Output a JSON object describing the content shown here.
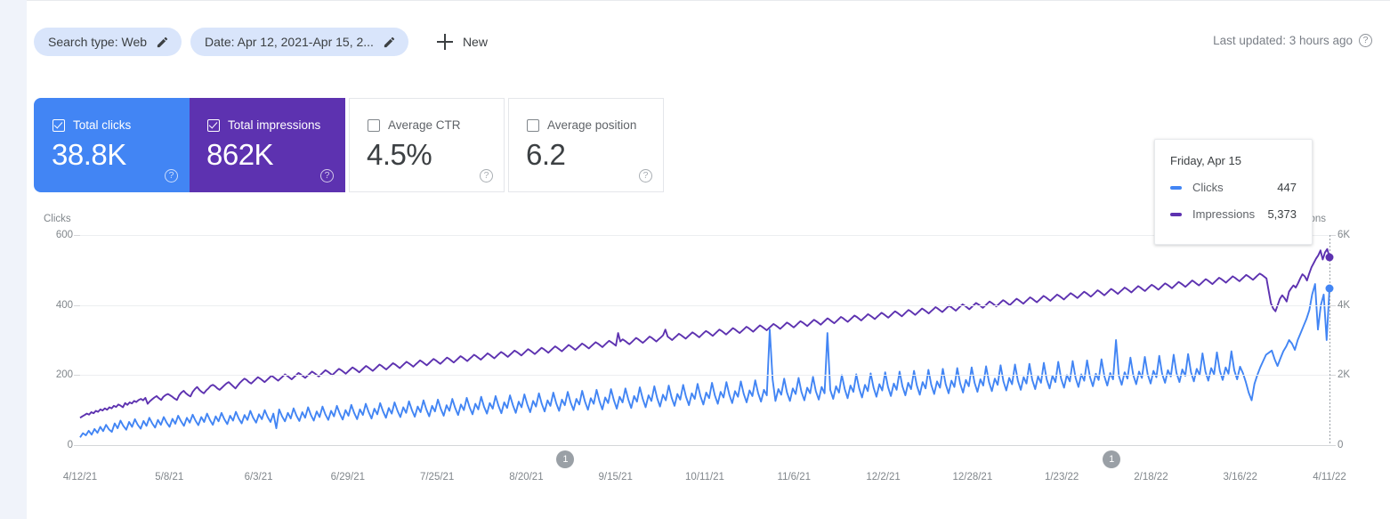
{
  "toolbar": {
    "chips": [
      {
        "label": "Search type: Web",
        "icon": "pencil-icon"
      },
      {
        "label": "Date: Apr 12, 2021-Apr 15, 2...",
        "icon": "pencil-icon"
      }
    ],
    "new_label": "New",
    "new_icon": "plus-icon",
    "last_updated": "Last updated: 3 hours ago",
    "help_icon": "help-circle-icon"
  },
  "metric_cards": [
    {
      "label": "Total clicks",
      "value": "38.8K",
      "checked": true,
      "color": "#4285f4",
      "help_icon": "help-circle-icon"
    },
    {
      "label": "Total impressions",
      "value": "862K",
      "checked": true,
      "color": "#5d32b0",
      "help_icon": "help-circle-icon"
    },
    {
      "label": "Average CTR",
      "value": "4.5%",
      "checked": false,
      "color": "#ffffff",
      "help_icon": "help-circle-icon"
    },
    {
      "label": "Average position",
      "value": "6.2",
      "checked": false,
      "color": "#ffffff",
      "help_icon": "help-circle-icon"
    }
  ],
  "tooltip": {
    "title": "Friday, Apr 15",
    "rows": [
      {
        "name": "Clicks",
        "value": "447",
        "color": "#4285f4"
      },
      {
        "name": "Impressions",
        "value": "5,373",
        "color": "#5d32b0"
      }
    ]
  },
  "annotations": [
    {
      "label": "1",
      "x_frac": 0.3885
    },
    {
      "label": "1",
      "x_frac": 0.8256
    }
  ],
  "chart_data": {
    "type": "line",
    "title": "",
    "xlabel": "",
    "ylabel": "Clicks",
    "y2label": "Impressions",
    "grid": true,
    "legend": "tooltip",
    "ylim": [
      0,
      600
    ],
    "y2lim": [
      0,
      6000
    ],
    "yticks": [
      "0",
      "200",
      "400",
      "600"
    ],
    "y2ticks": [
      "0",
      "2K",
      "4K",
      "6K"
    ],
    "xticks": [
      "4/12/21",
      "5/8/21",
      "6/3/21",
      "6/29/21",
      "7/25/21",
      "8/20/21",
      "9/15/21",
      "10/11/21",
      "11/6/21",
      "12/2/21",
      "12/28/21",
      "1/23/22",
      "2/18/22",
      "3/16/22",
      "4/11/22"
    ],
    "x_range": [
      "4/12/21",
      "4/15/22"
    ],
    "series": [
      {
        "name": "Clicks",
        "color": "#4285f4",
        "axis": "left",
        "end_value": 447,
        "values": [
          22,
          34,
          28,
          41,
          30,
          46,
          35,
          52,
          40,
          58,
          45,
          38,
          62,
          48,
          70,
          55,
          44,
          66,
          52,
          74,
          58,
          47,
          69,
          55,
          78,
          62,
          50,
          72,
          58,
          80,
          64,
          52,
          75,
          61,
          84,
          68,
          55,
          78,
          64,
          87,
          70,
          57,
          80,
          66,
          90,
          72,
          58,
          82,
          68,
          92,
          74,
          60,
          84,
          70,
          95,
          76,
          62,
          86,
          72,
          98,
          78,
          64,
          88,
          74,
          100,
          80,
          66,
          90,
          48,
          102,
          82,
          68,
          92,
          76,
          105,
          84,
          69,
          94,
          78,
          108,
          86,
          70,
          96,
          80,
          110,
          88,
          72,
          98,
          82,
          112,
          90,
          73,
          100,
          84,
          115,
          92,
          74,
          102,
          86,
          118,
          95,
          76,
          104,
          88,
          120,
          96,
          78,
          106,
          90,
          122,
          98,
          80,
          108,
          92,
          125,
          100,
          81,
          110,
          94,
          128,
          102,
          82,
          112,
          96,
          130,
          104,
          84,
          114,
          98,
          132,
          106,
          86,
          116,
          100,
          135,
          108,
          88,
          118,
          102,
          138,
          110,
          90,
          120,
          104,
          140,
          112,
          91,
          122,
          106,
          142,
          114,
          92,
          124,
          108,
          145,
          116,
          94,
          126,
          110,
          148,
          118,
          96,
          128,
          112,
          150,
          120,
          98,
          130,
          114,
          152,
          122,
          100,
          132,
          116,
          155,
          124,
          101,
          134,
          118,
          158,
          126,
          102,
          136,
          120,
          160,
          128,
          104,
          138,
          122,
          162,
          130,
          106,
          140,
          124,
          165,
          132,
          108,
          142,
          126,
          168,
          134,
          110,
          144,
          128,
          170,
          136,
          112,
          146,
          130,
          172,
          138,
          114,
          148,
          132,
          175,
          140,
          116,
          150,
          134,
          178,
          142,
          118,
          152,
          136,
          180,
          144,
          120,
          154,
          138,
          182,
          146,
          122,
          156,
          140,
          185,
          148,
          124,
          158,
          142,
          330,
          188,
          126,
          160,
          144,
          190,
          150,
          126,
          162,
          146,
          192,
          152,
          128,
          164,
          148,
          195,
          154,
          130,
          166,
          148,
          320,
          158,
          132,
          168,
          150,
          200,
          160,
          134,
          170,
          152,
          202,
          162,
          136,
          172,
          154,
          205,
          164,
          138,
          174,
          156,
          208,
          166,
          140,
          176,
          158,
          210,
          168,
          142,
          178,
          160,
          212,
          170,
          144,
          180,
          162,
          215,
          172,
          146,
          182,
          164,
          218,
          174,
          148,
          184,
          166,
          220,
          176,
          150,
          186,
          168,
          222,
          178,
          152,
          188,
          170,
          225,
          180,
          154,
          190,
          172,
          228,
          182,
          156,
          192,
          174,
          230,
          184,
          158,
          194,
          176,
          232,
          186,
          160,
          196,
          178,
          235,
          188,
          162,
          198,
          180,
          238,
          190,
          164,
          200,
          182,
          240,
          192,
          166,
          202,
          184,
          242,
          194,
          168,
          204,
          186,
          245,
          196,
          170,
          206,
          188,
          300,
          198,
          172,
          208,
          190,
          250,
          200,
          174,
          210,
          192,
          252,
          202,
          176,
          212,
          194,
          255,
          204,
          178,
          214,
          196,
          258,
          206,
          180,
          216,
          198,
          260,
          208,
          182,
          218,
          200,
          262,
          210,
          184,
          220,
          202,
          265,
          212,
          186,
          222,
          204,
          268,
          214,
          188,
          224,
          206,
          180,
          150,
          128,
          175,
          200,
          222,
          240,
          258,
          264,
          270,
          245,
          226,
          248,
          268,
          282,
          300,
          290,
          272,
          300,
          320,
          340,
          360,
          385,
          430,
          460,
          330,
          400,
          430,
          300,
          447
        ]
      },
      {
        "name": "Impressions",
        "color": "#5d32b0",
        "axis": "right",
        "end_value": 5373,
        "values": [
          780,
          820,
          860,
          900,
          870,
          940,
          910,
          980,
          950,
          1020,
          990,
          1050,
          1010,
          1080,
          1050,
          1120,
          1090,
          1160,
          1130,
          1080,
          1200,
          1150,
          1220,
          1190,
          1260,
          1230,
          1290,
          1320,
          1280,
          1350,
          1180,
          1250,
          1310,
          1360,
          1400,
          1340,
          1290,
          1380,
          1430,
          1460,
          1420,
          1380,
          1330,
          1290,
          1420,
          1500,
          1550,
          1480,
          1430,
          1390,
          1520,
          1600,
          1660,
          1580,
          1520,
          1480,
          1560,
          1620,
          1690,
          1720,
          1680,
          1620,
          1580,
          1640,
          1700,
          1760,
          1800,
          1740,
          1680,
          1620,
          1700,
          1780,
          1840,
          1900,
          1860,
          1800,
          1760,
          1820,
          1880,
          1940,
          1900,
          1850,
          1800,
          1860,
          1920,
          1980,
          1940,
          1890,
          1840,
          1900,
          1960,
          2020,
          1980,
          1930,
          1880,
          1940,
          2000,
          2060,
          2020,
          1970,
          1920,
          1980,
          2040,
          2100,
          2060,
          2010,
          1960,
          2020,
          2080,
          2140,
          2100,
          2050,
          2000,
          2060,
          2120,
          2180,
          2140,
          2090,
          2040,
          2100,
          2160,
          2220,
          2180,
          2130,
          2080,
          2140,
          2200,
          2260,
          2220,
          2170,
          2120,
          2180,
          2240,
          2300,
          2260,
          2210,
          2160,
          2220,
          2280,
          2340,
          2300,
          2250,
          2200,
          2260,
          2320,
          2380,
          2340,
          2290,
          2240,
          2300,
          2360,
          2420,
          2380,
          2330,
          2280,
          2340,
          2400,
          2460,
          2420,
          2370,
          2320,
          2380,
          2440,
          2500,
          2460,
          2410,
          2360,
          2420,
          2480,
          2540,
          2500,
          2450,
          2400,
          2460,
          2520,
          2580,
          2540,
          2490,
          2440,
          2500,
          2560,
          2620,
          2580,
          2530,
          2480,
          2540,
          2600,
          2660,
          2620,
          2570,
          2520,
          2580,
          2640,
          2700,
          2660,
          2610,
          2560,
          2620,
          2680,
          2740,
          2700,
          2650,
          2600,
          2660,
          2720,
          2780,
          2740,
          2690,
          2640,
          2700,
          2760,
          2820,
          2780,
          2730,
          2680,
          2740,
          2800,
          2860,
          2820,
          2770,
          2720,
          2780,
          2840,
          2900,
          2860,
          2810,
          2760,
          2820,
          2880,
          2940,
          2900,
          2850,
          2800,
          2860,
          2920,
          2980,
          2940,
          2890,
          2840,
          3200,
          2960,
          3020,
          2980,
          2930,
          2880,
          2940,
          3000,
          3060,
          3020,
          2970,
          2920,
          2980,
          3040,
          3100,
          3060,
          3010,
          2960,
          3020,
          3080,
          3140,
          3300,
          3100,
          3050,
          3000,
          3060,
          3120,
          3180,
          3140,
          3090,
          3040,
          3100,
          3160,
          3220,
          3180,
          3130,
          3080,
          3140,
          3200,
          3260,
          3220,
          3170,
          3120,
          3180,
          3240,
          3300,
          3260,
          3210,
          3160,
          3220,
          3280,
          3340,
          3300,
          3250,
          3200,
          3260,
          3320,
          3380,
          3340,
          3290,
          3240,
          3300,
          3360,
          3420,
          3380,
          3330,
          3280,
          3340,
          3400,
          3460,
          3420,
          3370,
          3320,
          3380,
          3440,
          3500,
          3460,
          3410,
          3360,
          3420,
          3480,
          3540,
          3500,
          3450,
          3400,
          3460,
          3520,
          3580,
          3540,
          3490,
          3440,
          3500,
          3560,
          3620,
          3580,
          3530,
          3480,
          3540,
          3600,
          3660,
          3620,
          3570,
          3520,
          3580,
          3640,
          3700,
          3660,
          3610,
          3560,
          3620,
          3680,
          3740,
          3700,
          3650,
          3600,
          3660,
          3720,
          3780,
          3740,
          3690,
          3640,
          3700,
          3760,
          3820,
          3780,
          3730,
          3680,
          3740,
          3800,
          3860,
          3820,
          3770,
          3720,
          3780,
          3840,
          3900,
          3860,
          3810,
          3760,
          3820,
          3880,
          3940,
          3900,
          3850,
          3800,
          3860,
          3920,
          3980,
          3940,
          3890,
          3840,
          3900,
          3960,
          4020,
          3980,
          3930,
          3880,
          3940,
          4000,
          4060,
          4020,
          3970,
          3920,
          3980,
          4040,
          4100,
          4060,
          4010,
          3960,
          4020,
          4080,
          4140,
          4100,
          4050,
          4000,
          4060,
          4120,
          4180,
          4140,
          4090,
          4040,
          4100,
          4160,
          4220,
          4180,
          4130,
          4080,
          4140,
          4200,
          4260,
          4220,
          4170,
          4120,
          4180,
          4240,
          4300,
          4260,
          4210,
          4160,
          4220,
          4280,
          4340,
          4300,
          4250,
          4200,
          4260,
          4320,
          4380,
          4340,
          4290,
          4240,
          4300,
          4360,
          4420,
          4380,
          4330,
          4280,
          4340,
          4400,
          4460,
          4420,
          4370,
          4320,
          4380,
          4440,
          4500,
          4460,
          4410,
          4360,
          4420,
          4480,
          4540,
          4500,
          4450,
          4400,
          4460,
          4520,
          4580,
          4540,
          4490,
          4440,
          4500,
          4560,
          4620,
          4580,
          4530,
          4480,
          4540,
          4600,
          4660,
          4620,
          4570,
          4520,
          4580,
          4640,
          4700,
          4660,
          4610,
          4560,
          4620,
          4680,
          4740,
          4700,
          4650,
          4600,
          4660,
          4720,
          4780,
          4740,
          4690,
          4640,
          4700,
          4760,
          4820,
          4780,
          4730,
          4680,
          4740,
          4800,
          4860,
          4820,
          4770,
          4720,
          4780,
          4840,
          4900,
          4860,
          4810,
          4760,
          4400,
          4050,
          3900,
          3820,
          4000,
          4180,
          4280,
          4200,
          4100,
          4380,
          4480,
          4560,
          4500,
          4620,
          4760,
          4880,
          4820,
          4700,
          4900,
          5080,
          5200,
          5320,
          5420,
          5560,
          5300,
          5500,
          5600,
          5373
        ]
      }
    ]
  }
}
